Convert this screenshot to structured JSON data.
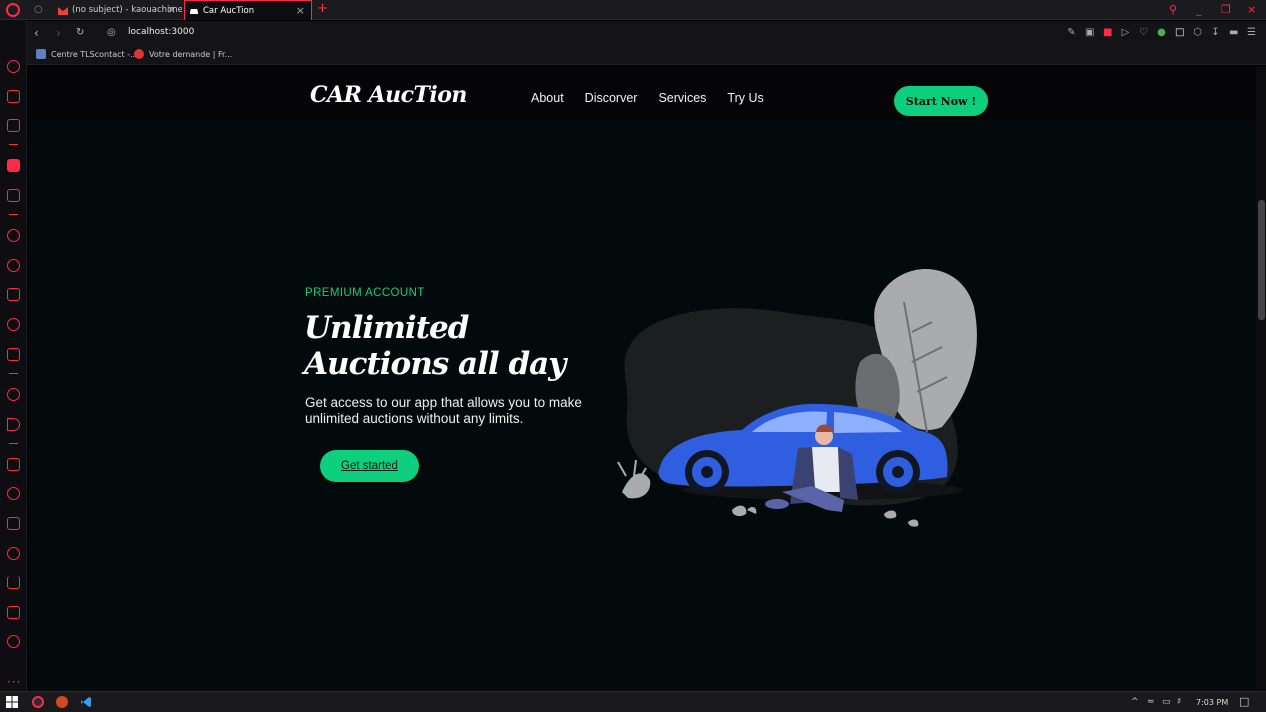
{
  "browser": {
    "tabs": [
      {
        "label": "(no subject) - kaouachimel"
      },
      {
        "label": "Car AucTion"
      }
    ],
    "url": "localhost:3000",
    "bookmarks": [
      {
        "label": "Centre TLScontact -..."
      },
      {
        "label": "Votre demande | Fr..."
      }
    ]
  },
  "site": {
    "logo": "CAR AucTion",
    "nav": [
      "About",
      "Discorver",
      "Services",
      "Try Us"
    ],
    "cta_label": "Start Now !"
  },
  "hero": {
    "eyebrow": "PREMIUM ACCOUNT",
    "title": "Unlimited Auctions all day",
    "text": "Get access to our app that allows you to make unlimited auctions without any limits.",
    "button_label": "Get started"
  },
  "taskbar": {
    "time": "7:03 PM"
  },
  "colors": {
    "accent": "#0dcf7e",
    "browser_accent": "#ff2a46",
    "page_background": "#030a0c",
    "car_blue": "#2f5fe0"
  }
}
